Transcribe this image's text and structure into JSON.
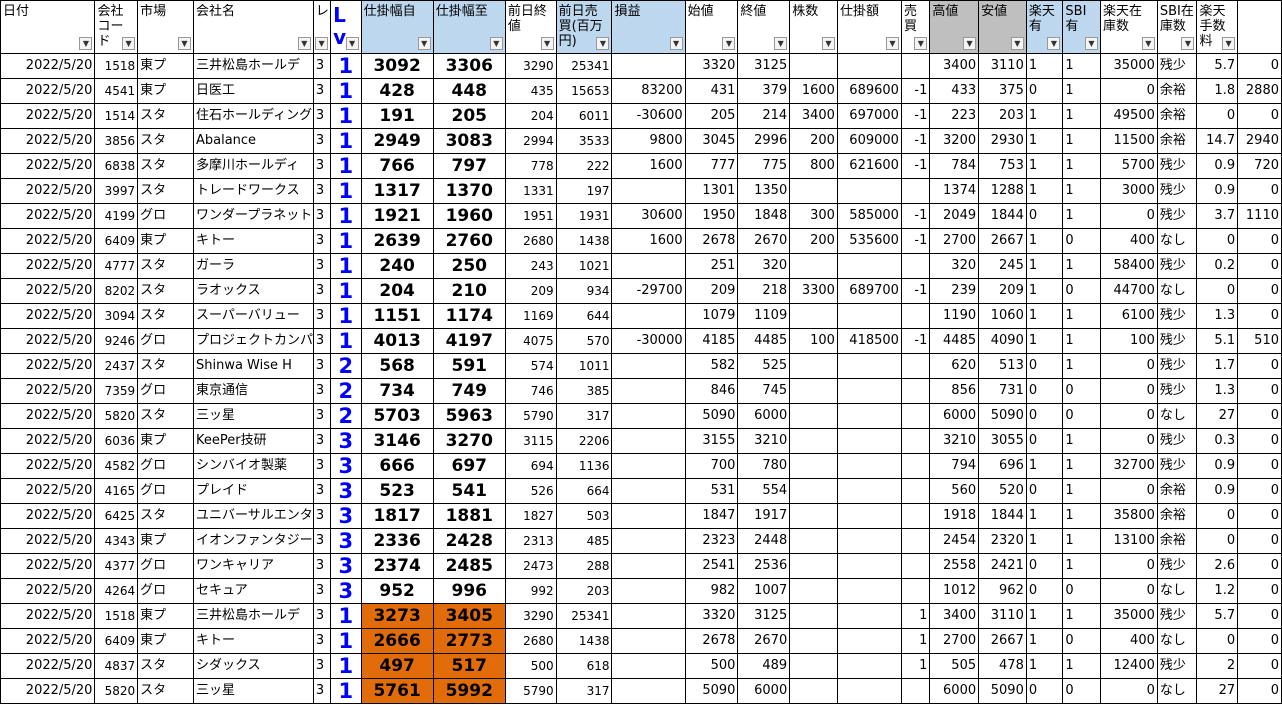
{
  "headers": [
    "日付",
    "会社コード",
    "市場",
    "会社名",
    "レ",
    "Lv",
    "仕掛幅自",
    "仕掛幅至",
    "前日終値",
    "前日売買(百万円)",
    "損益",
    "始値",
    "終値",
    "株数",
    "仕掛額",
    "売買",
    "高値",
    "安値",
    "楽天有",
    "SBI有",
    "楽天在庫数",
    "SBI在庫数",
    "楽天手数料",
    ""
  ],
  "rows": [
    [
      "2022/5/20",
      "1518",
      "東プ",
      "三井松島ホールデ",
      "3",
      "1",
      "3092",
      "3306",
      "3290",
      "25341",
      "",
      "3320",
      "3125",
      "",
      "",
      "",
      "3400",
      "3110",
      "1",
      "1",
      "35000",
      "残少",
      "5.7",
      "0"
    ],
    [
      "2022/5/20",
      "4541",
      "東プ",
      "日医工",
      "3",
      "1",
      "428",
      "448",
      "435",
      "15653",
      "83200",
      "431",
      "379",
      "1600",
      "689600",
      "-1",
      "433",
      "375",
      "0",
      "1",
      "0",
      "余裕",
      "1.8",
      "2880"
    ],
    [
      "2022/5/20",
      "1514",
      "スタ",
      "住石ホールディング",
      "3",
      "1",
      "191",
      "205",
      "204",
      "6011",
      "-30600",
      "205",
      "214",
      "3400",
      "697000",
      "-1",
      "223",
      "203",
      "1",
      "1",
      "49500",
      "余裕",
      "0",
      "0"
    ],
    [
      "2022/5/20",
      "3856",
      "スタ",
      "Abalance",
      "3",
      "1",
      "2949",
      "3083",
      "2994",
      "3533",
      "9800",
      "3045",
      "2996",
      "200",
      "609000",
      "-1",
      "3200",
      "2930",
      "1",
      "1",
      "11500",
      "余裕",
      "14.7",
      "2940"
    ],
    [
      "2022/5/20",
      "6838",
      "スタ",
      "多摩川ホールディ",
      "3",
      "1",
      "766",
      "797",
      "778",
      "222",
      "1600",
      "777",
      "775",
      "800",
      "621600",
      "-1",
      "784",
      "753",
      "1",
      "1",
      "5700",
      "残少",
      "0.9",
      "720"
    ],
    [
      "2022/5/20",
      "3997",
      "スタ",
      "トレードワークス",
      "3",
      "1",
      "1317",
      "1370",
      "1331",
      "197",
      "",
      "1301",
      "1350",
      "",
      "",
      "",
      "1374",
      "1288",
      "1",
      "1",
      "3000",
      "残少",
      "0.9",
      "0"
    ],
    [
      "2022/5/20",
      "4199",
      "グロ",
      "ワンダープラネット",
      "3",
      "1",
      "1921",
      "1960",
      "1951",
      "1931",
      "30600",
      "1950",
      "1848",
      "300",
      "585000",
      "-1",
      "2049",
      "1844",
      "0",
      "1",
      "0",
      "残少",
      "3.7",
      "1110"
    ],
    [
      "2022/5/20",
      "6409",
      "東プ",
      "キトー",
      "3",
      "1",
      "2639",
      "2760",
      "2680",
      "1438",
      "1600",
      "2678",
      "2670",
      "200",
      "535600",
      "-1",
      "2700",
      "2667",
      "1",
      "0",
      "400",
      "なし",
      "0",
      "0"
    ],
    [
      "2022/5/20",
      "4777",
      "スタ",
      "ガーラ",
      "3",
      "1",
      "240",
      "250",
      "243",
      "1021",
      "",
      "251",
      "320",
      "",
      "",
      "",
      "320",
      "245",
      "1",
      "1",
      "58400",
      "残少",
      "0.2",
      "0"
    ],
    [
      "2022/5/20",
      "8202",
      "スタ",
      "ラオックス",
      "3",
      "1",
      "204",
      "210",
      "209",
      "934",
      "-29700",
      "209",
      "218",
      "3300",
      "689700",
      "-1",
      "239",
      "209",
      "1",
      "0",
      "44700",
      "なし",
      "0",
      "0"
    ],
    [
      "2022/5/20",
      "3094",
      "スタ",
      "スーパーバリュー",
      "3",
      "1",
      "1151",
      "1174",
      "1169",
      "644",
      "",
      "1079",
      "1109",
      "",
      "",
      "",
      "1190",
      "1060",
      "1",
      "1",
      "6100",
      "残少",
      "1.3",
      "0"
    ],
    [
      "2022/5/20",
      "9246",
      "グロ",
      "プロジェクトカンパ",
      "3",
      "1",
      "4013",
      "4197",
      "4075",
      "570",
      "-30000",
      "4185",
      "4485",
      "100",
      "418500",
      "-1",
      "4485",
      "4090",
      "1",
      "1",
      "100",
      "残少",
      "5.1",
      "510"
    ],
    [
      "2022/5/20",
      "2437",
      "スタ",
      "Shinwa Wise H",
      "3",
      "2",
      "568",
      "591",
      "574",
      "1011",
      "",
      "582",
      "525",
      "",
      "",
      "",
      "620",
      "513",
      "0",
      "1",
      "0",
      "残少",
      "1.7",
      "0"
    ],
    [
      "2022/5/20",
      "7359",
      "グロ",
      "東京通信",
      "3",
      "2",
      "734",
      "749",
      "746",
      "385",
      "",
      "846",
      "745",
      "",
      "",
      "",
      "856",
      "731",
      "0",
      "0",
      "0",
      "残少",
      "1.3",
      "0"
    ],
    [
      "2022/5/20",
      "5820",
      "スタ",
      "三ッ星",
      "3",
      "2",
      "5703",
      "5963",
      "5790",
      "317",
      "",
      "5090",
      "6000",
      "",
      "",
      "",
      "6000",
      "5090",
      "0",
      "0",
      "0",
      "なし",
      "27",
      "0"
    ],
    [
      "2022/5/20",
      "6036",
      "東プ",
      "KeePer技研",
      "3",
      "3",
      "3146",
      "3270",
      "3115",
      "2206",
      "",
      "3155",
      "3210",
      "",
      "",
      "",
      "3210",
      "3055",
      "0",
      "1",
      "0",
      "残少",
      "0.3",
      "0"
    ],
    [
      "2022/5/20",
      "4582",
      "グロ",
      "シンバイオ製薬",
      "3",
      "3",
      "666",
      "697",
      "694",
      "1136",
      "",
      "700",
      "780",
      "",
      "",
      "",
      "794",
      "696",
      "1",
      "1",
      "32700",
      "残少",
      "0.9",
      "0"
    ],
    [
      "2022/5/20",
      "4165",
      "グロ",
      "プレイド",
      "3",
      "3",
      "523",
      "541",
      "526",
      "664",
      "",
      "531",
      "554",
      "",
      "",
      "",
      "560",
      "520",
      "0",
      "1",
      "0",
      "余裕",
      "0.9",
      "0"
    ],
    [
      "2022/5/20",
      "6425",
      "スタ",
      "ユニバーサルエンタ",
      "3",
      "3",
      "1817",
      "1881",
      "1827",
      "503",
      "",
      "1847",
      "1917",
      "",
      "",
      "",
      "1918",
      "1844",
      "1",
      "1",
      "35800",
      "余裕",
      "0",
      "0"
    ],
    [
      "2022/5/20",
      "4343",
      "東プ",
      "イオンファンタジー",
      "3",
      "3",
      "2336",
      "2428",
      "2313",
      "485",
      "",
      "2323",
      "2448",
      "",
      "",
      "",
      "2454",
      "2320",
      "1",
      "1",
      "13100",
      "余裕",
      "0",
      "0"
    ],
    [
      "2022/5/20",
      "4377",
      "グロ",
      "ワンキャリア",
      "3",
      "3",
      "2374",
      "2485",
      "2473",
      "288",
      "",
      "2541",
      "2536",
      "",
      "",
      "",
      "2558",
      "2421",
      "0",
      "1",
      "0",
      "残少",
      "2.6",
      "0"
    ],
    [
      "2022/5/20",
      "4264",
      "グロ",
      "セキュア",
      "3",
      "3",
      "952",
      "996",
      "992",
      "203",
      "",
      "982",
      "1007",
      "",
      "",
      "",
      "1012",
      "962",
      "0",
      "0",
      "0",
      "なし",
      "1.2",
      "0"
    ],
    [
      "2022/5/20",
      "1518",
      "東プ",
      "三井松島ホールデ",
      "3",
      "1",
      "3273",
      "3405",
      "3290",
      "25341",
      "",
      "3320",
      "3125",
      "",
      "",
      "1",
      "3400",
      "3110",
      "1",
      "1",
      "35000",
      "残少",
      "5.7",
      "0"
    ],
    [
      "2022/5/20",
      "6409",
      "東プ",
      "キトー",
      "3",
      "1",
      "2666",
      "2773",
      "2680",
      "1438",
      "",
      "2678",
      "2670",
      "",
      "",
      "1",
      "2700",
      "2667",
      "1",
      "0",
      "400",
      "なし",
      "0",
      "0"
    ],
    [
      "2022/5/20",
      "4837",
      "スタ",
      "シダックス",
      "3",
      "1",
      "497",
      "517",
      "500",
      "618",
      "",
      "500",
      "489",
      "",
      "",
      "1",
      "505",
      "478",
      "1",
      "1",
      "12400",
      "残少",
      "2",
      "0"
    ],
    [
      "2022/5/20",
      "5820",
      "スタ",
      "三ッ星",
      "3",
      "1",
      "5761",
      "5992",
      "5790",
      "317",
      "",
      "5090",
      "6000",
      "",
      "",
      "",
      "6000",
      "5090",
      "0",
      "0",
      "0",
      "なし",
      "27",
      "0"
    ]
  ],
  "highlight_rows": [
    22,
    23,
    24,
    25
  ],
  "colors": {
    "header_blue": "#bdd7ee",
    "header_gray": "#bfbfbf",
    "highlight_orange": "#e26b0a",
    "lv_blue": "#0000ff"
  },
  "filter_icon": "dropdown-arrow-icon"
}
